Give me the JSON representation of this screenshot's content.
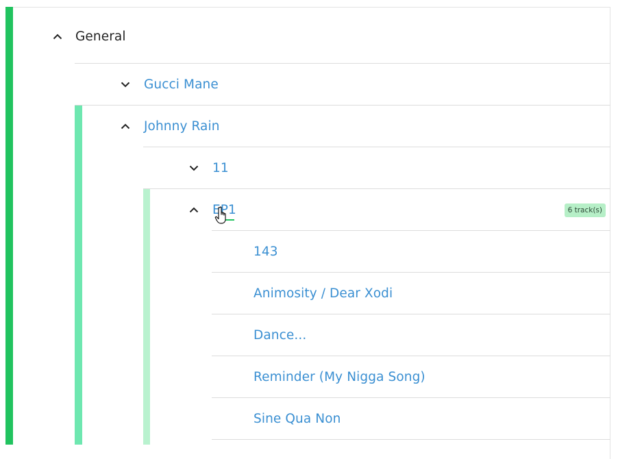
{
  "tree": {
    "general": {
      "label": "General",
      "expanded": true
    },
    "gucci_mane": {
      "label": "Gucci Mane",
      "expanded": false
    },
    "johnny_rain": {
      "label": "Johnny Rain",
      "expanded": true
    },
    "album_11": {
      "label": "11",
      "expanded": false
    },
    "album_ep1": {
      "label": "EP1",
      "expanded": true,
      "badge": "6 track(s)"
    },
    "tracks": [
      {
        "label": "143"
      },
      {
        "label": "Animosity / Dear Xodi"
      },
      {
        "label": "Dance..."
      },
      {
        "label": "Reminder (My Nigga Song)"
      },
      {
        "label": "Sine Qua Non"
      }
    ]
  },
  "colors": {
    "level1_bar": "#21c35f",
    "level2_bar": "#6ee7b0",
    "level3_bar": "#b9f2cf",
    "link": "#3a8fd2",
    "badge_bg": "#b6efc7"
  }
}
